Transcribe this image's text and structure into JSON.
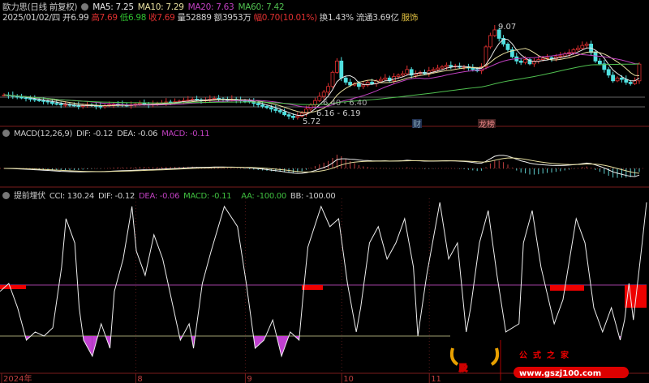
{
  "header": {
    "title": "歐力思(日线 前复权)",
    "ma": [
      {
        "label": "MA5: 7.25",
        "color": "#e8e8e8"
      },
      {
        "label": "MA10: 7.29",
        "color": "#e8e0a0"
      },
      {
        "label": "MA20: 7.63",
        "color": "#c040c0"
      },
      {
        "label": "MA60: 7.42",
        "color": "#50c050"
      }
    ],
    "quote": [
      {
        "text": "2025/01/02/四 开6.99",
        "color": "#d0d0d0"
      },
      {
        "text": "高7.69",
        "color": "#e03030"
      },
      {
        "text": "低6.98",
        "color": "#30c030"
      },
      {
        "text": "收7.69",
        "color": "#e03030"
      },
      {
        "text": "量52889",
        "color": "#d0d0d0"
      },
      {
        "text": "额3953万",
        "color": "#d0d0d0"
      },
      {
        "text": "幅0.70(10.01%)",
        "color": "#e03030"
      },
      {
        "text": "换1.43%",
        "color": "#d0d0d0"
      },
      {
        "text": "流通3.69亿",
        "color": "#d0d0d0"
      },
      {
        "text": "服饰",
        "color": "#e0c040"
      }
    ]
  },
  "annotations": {
    "high": "9.07",
    "low": "5.72",
    "gap1": "6.40 - 6.40",
    "gap2": "6.16 - 6.19",
    "badge_fin": "财",
    "badge_rank": "龙榜"
  },
  "macd_header": {
    "name": "MACD(12,26,9)",
    "dif": "DIF: -0.12",
    "dea": "DEA: -0.06",
    "macd": "MACD: -0.11"
  },
  "cci_header": {
    "name": "提前埋伏",
    "cci": "CCI: 130.24",
    "dif": "DIF: -0.12",
    "dea": "DEA: -0.06",
    "macd": "MACD: -0.11",
    "aa": "AA: -100.00",
    "bb": "BB: -100.00"
  },
  "xaxis": [
    {
      "label": "2024年",
      "idx": 0
    },
    {
      "label": "8",
      "idx": 31
    },
    {
      "label": "9",
      "idx": 56
    },
    {
      "label": "10",
      "idx": 78
    },
    {
      "label": "11",
      "idx": 98
    }
  ],
  "watermark": {
    "logo": "股",
    "name": "公式之家",
    "url": "www.gszj100.com"
  },
  "colors": {
    "up": "#e03030",
    "down": "#50e0e0",
    "ma5": "#e8e8e8",
    "ma10": "#e8e0a0",
    "ma20": "#c040c0",
    "ma60": "#50c050"
  },
  "chart_data": {
    "type": "candlestick",
    "price_range": [
      5.72,
      9.07
    ],
    "closes": [
      6.6,
      6.58,
      6.55,
      6.52,
      6.5,
      6.48,
      6.45,
      6.42,
      6.4,
      6.38,
      6.35,
      6.3,
      6.28,
      6.25,
      6.26,
      6.24,
      6.22,
      6.2,
      6.22,
      6.25,
      6.23,
      6.2,
      6.18,
      6.22,
      6.25,
      6.28,
      6.26,
      6.24,
      6.22,
      6.25,
      6.28,
      6.3,
      6.27,
      6.25,
      6.28,
      6.3,
      6.32,
      6.35,
      6.33,
      6.36,
      6.38,
      6.4,
      6.42,
      6.45,
      6.43,
      6.4,
      6.42,
      6.45,
      6.48,
      6.46,
      6.44,
      6.42,
      6.45,
      6.42,
      6.4,
      6.38,
      6.35,
      6.3,
      6.25,
      6.2,
      6.15,
      6.1,
      6.05,
      6.0,
      5.9,
      5.85,
      5.8,
      5.85,
      5.95,
      6.1,
      6.25,
      6.4,
      6.55,
      6.7,
      6.9,
      7.4,
      7.8,
      7.2,
      7.05,
      6.95,
      7.0,
      6.9,
      6.95,
      7.05,
      7.0,
      7.1,
      7.15,
      7.2,
      7.1,
      7.25,
      7.3,
      7.35,
      7.5,
      7.3,
      7.35,
      7.4,
      7.35,
      7.45,
      7.5,
      7.55,
      7.6,
      7.65,
      7.6,
      7.62,
      7.58,
      7.6,
      7.55,
      7.5,
      7.45,
      7.6,
      8.3,
      8.7,
      8.9,
      8.6,
      8.4,
      8.2,
      7.95,
      7.8,
      7.75,
      7.85,
      7.7,
      7.8,
      7.85,
      7.9,
      7.92,
      7.88,
      7.95,
      7.98,
      8.05,
      8.1,
      8.2,
      8.25,
      8.35,
      8.4,
      8.1,
      7.8,
      7.7,
      7.5,
      7.3,
      7.1,
      7.2,
      7.15,
      7.05,
      7.0,
      7.1,
      7.69
    ],
    "cci": {
      "levels": [
        100,
        -100
      ],
      "points": [
        [
          0,
          75
        ],
        [
          2,
          106
        ],
        [
          4,
          11
        ],
        [
          6,
          -116
        ],
        [
          8,
          -84
        ],
        [
          10,
          -100
        ],
        [
          12,
          -68
        ],
        [
          14,
          170
        ],
        [
          15,
          360
        ],
        [
          17,
          265
        ],
        [
          18,
          11
        ],
        [
          19,
          -116
        ],
        [
          21,
          -179
        ],
        [
          23,
          -52
        ],
        [
          25,
          -148
        ],
        [
          26,
          75
        ],
        [
          28,
          202
        ],
        [
          30,
          408
        ],
        [
          31,
          233
        ],
        [
          33,
          138
        ],
        [
          35,
          297
        ],
        [
          37,
          202
        ],
        [
          40,
          -37
        ],
        [
          41,
          -116
        ],
        [
          43,
          -52
        ],
        [
          44,
          -148
        ],
        [
          46,
          106
        ],
        [
          48,
          233
        ],
        [
          51,
          408
        ],
        [
          54,
          329
        ],
        [
          56,
          106
        ],
        [
          58,
          -148
        ],
        [
          60,
          -116
        ],
        [
          62,
          -37
        ],
        [
          64,
          -179
        ],
        [
          66,
          -84
        ],
        [
          68,
          -116
        ],
        [
          69,
          75
        ],
        [
          70,
          249
        ],
        [
          73,
          408
        ],
        [
          75,
          329
        ],
        [
          77,
          360
        ],
        [
          79,
          106
        ],
        [
          81,
          -84
        ],
        [
          82,
          11
        ],
        [
          84,
          265
        ],
        [
          86,
          329
        ],
        [
          88,
          202
        ],
        [
          90,
          265
        ],
        [
          92,
          360
        ],
        [
          94,
          170
        ],
        [
          95,
          -100
        ],
        [
          97,
          138
        ],
        [
          100,
          424
        ],
        [
          102,
          202
        ],
        [
          104,
          265
        ],
        [
          106,
          -84
        ],
        [
          107,
          11
        ],
        [
          109,
          265
        ],
        [
          111,
          392
        ],
        [
          113,
          138
        ],
        [
          115,
          -84
        ],
        [
          118,
          -52
        ],
        [
          119,
          265
        ],
        [
          121,
          392
        ],
        [
          123,
          170
        ],
        [
          126,
          -52
        ],
        [
          128,
          43
        ],
        [
          131,
          360
        ],
        [
          133,
          265
        ],
        [
          135,
          11
        ],
        [
          137,
          -84
        ],
        [
          139,
          11
        ],
        [
          141,
          -116
        ],
        [
          142,
          -37
        ],
        [
          143,
          106
        ],
        [
          144,
          -37
        ],
        [
          146,
          265
        ],
        [
          147,
          424
        ]
      ]
    }
  }
}
